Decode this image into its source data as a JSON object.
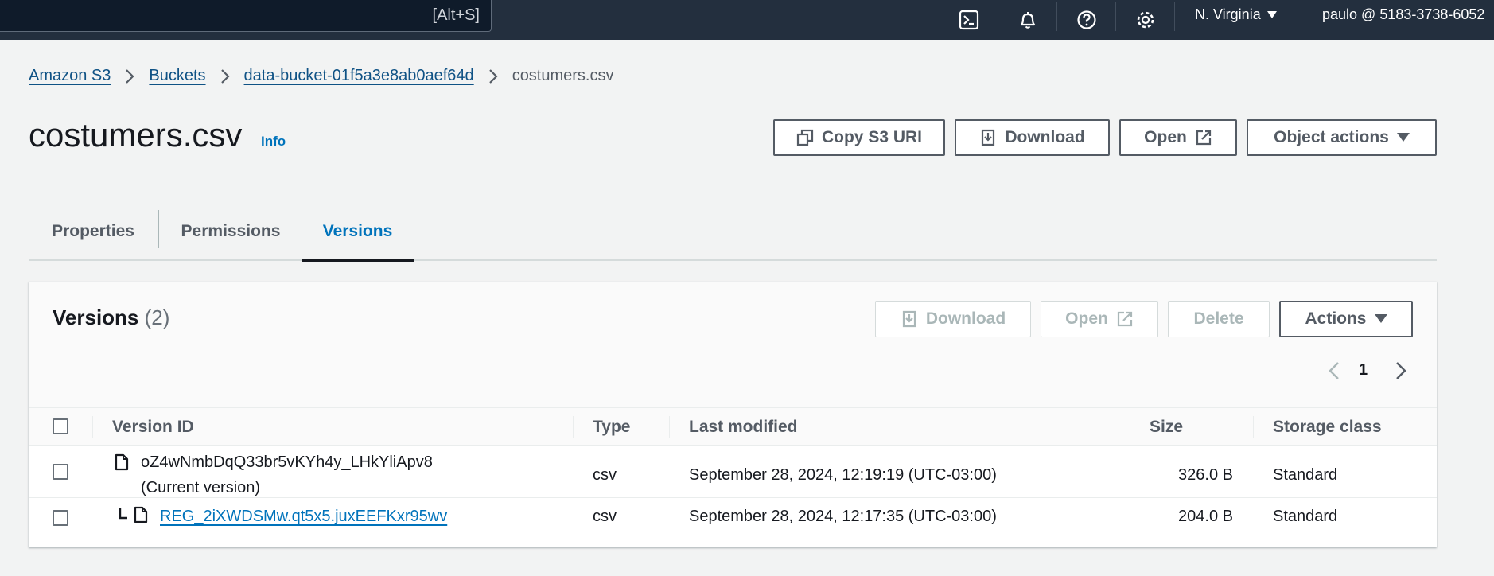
{
  "topnav": {
    "search_shortcut": "[Alt+S]",
    "region": "N. Virginia",
    "account": "paulo @ 5183-3738-6052",
    "icons": [
      "cloudshell-icon",
      "bell-icon",
      "help-icon",
      "gear-icon"
    ]
  },
  "breadcrumb": {
    "items": [
      "Amazon S3",
      "Buckets",
      "data-bucket-01f5a3e8ab0aef64d"
    ],
    "current": "costumers.csv"
  },
  "header": {
    "title": "costumers.csv",
    "info": "Info",
    "buttons": {
      "copy_uri": "Copy S3 URI",
      "download": "Download",
      "open": "Open",
      "object_actions": "Object actions"
    }
  },
  "tabs": {
    "properties": "Properties",
    "permissions": "Permissions",
    "versions": "Versions",
    "active": "Versions"
  },
  "versions": {
    "title": "Versions",
    "count": "(2)",
    "buttons": {
      "download": "Download",
      "open": "Open",
      "delete": "Delete",
      "actions": "Actions"
    },
    "page": "1",
    "columns": {
      "version_id": "Version ID",
      "type": "Type",
      "last_modified": "Last modified",
      "size": "Size",
      "storage_class": "Storage class"
    },
    "rows": [
      {
        "version_id": "oZ4wNmbDqQ33br5vKYh4y_LHkYliApv8",
        "note": "(Current version)",
        "type": "csv",
        "last_modified": "September 28, 2024, 12:19:19 (UTC-03:00)",
        "size": "326.0 B",
        "storage_class": "Standard"
      },
      {
        "version_id": "REG_2iXWDSMw.qt5x5.juxEEFKxr95wv",
        "type": "csv",
        "last_modified": "September 28, 2024, 12:17:35 (UTC-03:00)",
        "size": "204.0 B",
        "storage_class": "Standard"
      }
    ]
  },
  "colors": {
    "nav_bg": "#232f3e",
    "link": "#0073bb",
    "tab_active": "#0073bb",
    "page_bg": "#f2f3f3"
  }
}
